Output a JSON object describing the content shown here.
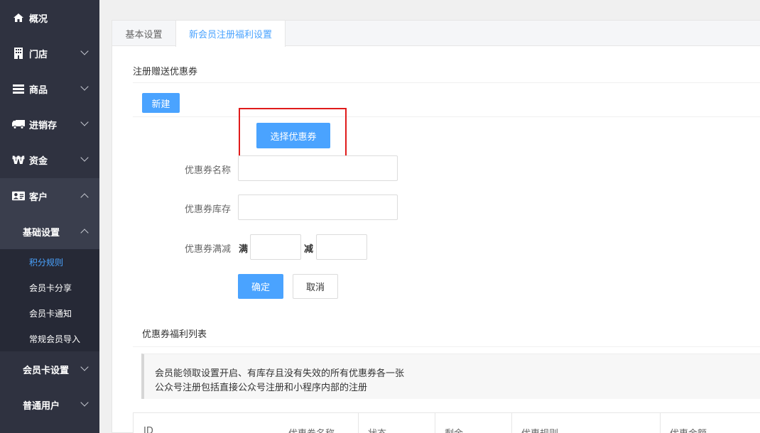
{
  "sidebar": {
    "items": [
      {
        "label": "概况",
        "icon": "home-icon"
      },
      {
        "label": "门店",
        "icon": "building-icon"
      },
      {
        "label": "商品",
        "icon": "list-icon"
      },
      {
        "label": "进销存",
        "icon": "truck-icon"
      },
      {
        "label": "资金",
        "icon": "won-icon"
      },
      {
        "label": "客户",
        "icon": "id-card-icon"
      }
    ],
    "sub_group": "基础设置",
    "leaves": [
      "积分规则",
      "会员卡分享",
      "会员卡通知",
      "常规会员导入"
    ],
    "sub_items": [
      "会员卡设置",
      "普通用户"
    ]
  },
  "tabs": [
    "基本设置",
    "新会员注册福利设置"
  ],
  "section1_title": "注册赠送优惠券",
  "new_button": "新建",
  "pick_button": "选择优惠券",
  "form": {
    "name_label": "优惠券名称",
    "stock_label": "优惠券库存",
    "discount_label": "优惠券满减",
    "full_label": "满",
    "minus_label": "减",
    "name_value": "",
    "stock_value": "",
    "full_value": "",
    "minus_value": ""
  },
  "confirm_button": "确定",
  "cancel_button": "取消",
  "section2_title": "优惠券福利列表",
  "notice": {
    "line1": "会员能领取设置开启、有库存且没有失效的所有优惠券各一张",
    "line2": "公众号注册包括直接公众号注册和小程序内部的注册"
  },
  "table_headers": [
    "ID",
    "优惠券名称",
    "状态",
    "剩余",
    "优惠规则",
    "优惠金额"
  ],
  "colors": {
    "accent": "#4aa3ff",
    "sidebar": "#2f3240",
    "highlight": "#e01b1b"
  }
}
